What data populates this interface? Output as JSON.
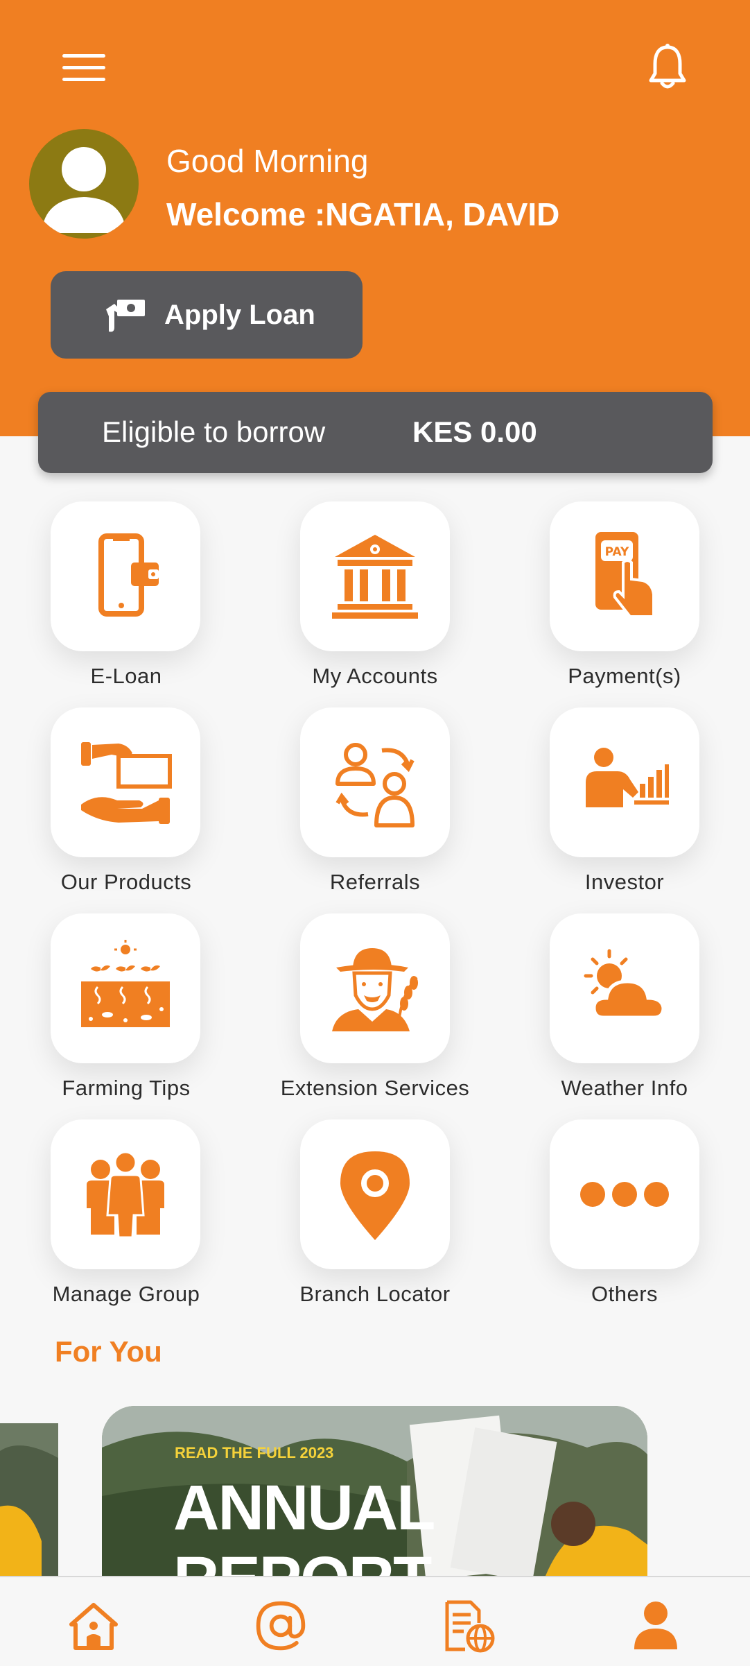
{
  "header": {
    "greeting": "Good Morning",
    "welcome": "Welcome :NGATIA, DAVID",
    "apply_loan_label": "Apply Loan",
    "brand_color": "#f07f22"
  },
  "borrow": {
    "label": "Eligible to borrow",
    "amount": "KES 0.00"
  },
  "menu": [
    {
      "label": "E-Loan",
      "icon": "phone-wallet-icon"
    },
    {
      "label": "My Accounts",
      "icon": "bank-icon"
    },
    {
      "label": "Payment(s)",
      "icon": "pay-phone-icon"
    },
    {
      "label": "Our Products",
      "icon": "hand-cash-icon"
    },
    {
      "label": "Referrals",
      "icon": "referral-users-icon"
    },
    {
      "label": "Investor",
      "icon": "investor-chart-icon"
    },
    {
      "label": "Farming Tips",
      "icon": "farming-icon"
    },
    {
      "label": "Extension Services",
      "icon": "farmer-icon"
    },
    {
      "label": "Weather Info",
      "icon": "weather-icon"
    },
    {
      "label": "Manage Group",
      "icon": "group-icon"
    },
    {
      "label": "Branch Locator",
      "icon": "location-pin-icon"
    },
    {
      "label": "Others",
      "icon": "more-dots-icon"
    }
  ],
  "for_you": {
    "title": "For You",
    "banner_small": "READ THE FULL 2023",
    "banner_big": "ANNUAL",
    "banner_big2": "REPORT"
  },
  "bottom_nav": [
    {
      "icon": "home-icon"
    },
    {
      "icon": "at-icon"
    },
    {
      "icon": "web-document-icon"
    },
    {
      "icon": "profile-icon"
    }
  ]
}
